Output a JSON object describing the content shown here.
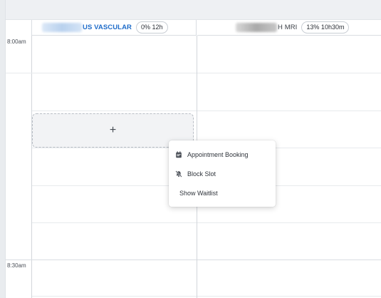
{
  "resources": [
    {
      "name": "US VASCULAR",
      "utilization": "0% 12h"
    },
    {
      "name": "H MRI",
      "utilization": "13% 10h30m"
    }
  ],
  "time_labels": [
    "8:00am",
    "8:30am"
  ],
  "slot_selection": {
    "icon": "plus-icon",
    "symbol": "+"
  },
  "context_menu": {
    "items": [
      {
        "label": "Appointment Booking",
        "icon": "calendar-icon"
      },
      {
        "label": "Block Slot",
        "icon": "bell-off-icon"
      },
      {
        "label": "Show Waitlist",
        "icon": ""
      }
    ]
  },
  "colors": {
    "accent": "#1f6cc9"
  }
}
